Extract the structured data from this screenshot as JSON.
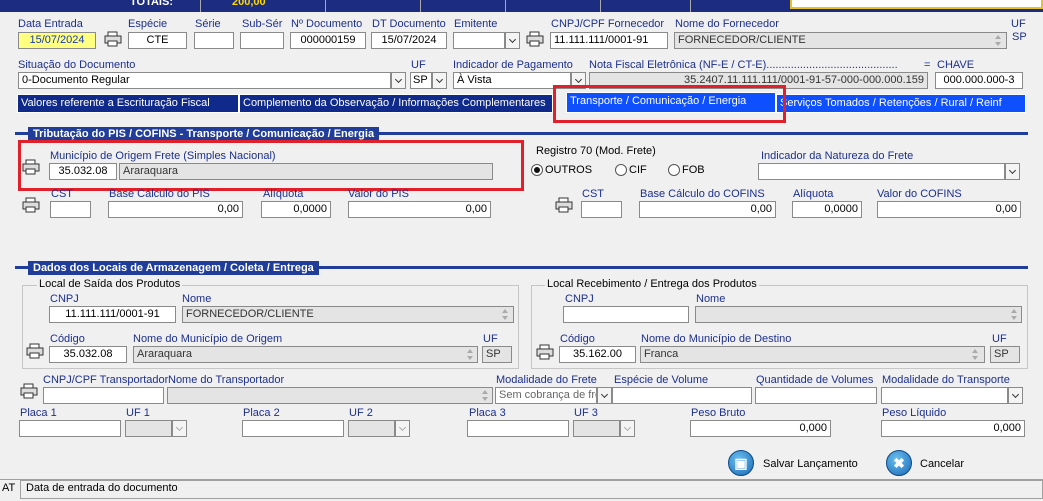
{
  "topbar": {
    "totais_label": "TOTAIS:",
    "totais_value": "200,00"
  },
  "header": {
    "data_entrada_label": "Data Entrada",
    "data_entrada": "15/07/2024",
    "especie_label": "Espécie",
    "especie": "CTE",
    "serie_label": "Série",
    "serie": "",
    "subserie_label": "Sub-Sér",
    "subserie": "",
    "ndoc_label": "Nº Documento",
    "ndoc": "000000159",
    "dtdoc_label": "DT Documento",
    "dtdoc": "15/07/2024",
    "emitente_label": "Emitente",
    "emitente": "",
    "cnpj_label": "CNPJ/CPF Fornecedor",
    "cnpj": "11.111.111/0001-91",
    "fornecedor_label": "Nome do Fornecedor",
    "fornecedor": "FORNECEDOR/CLIENTE",
    "uf_label": "UF",
    "uf": "SP"
  },
  "row2": {
    "situacao_label": "Situação do Documento",
    "situacao": "0-Documento Regular",
    "uf_label": "UF",
    "uf": "SP",
    "pagamento_label": "Indicador de Pagamento",
    "pagamento": "À Vista",
    "nfe_label": "Nota Fiscal Eletrônica (NF-E / CT-E)...........................................",
    "nfe": "35.2407.11.111.111/0001-91-57-000-000.000.159",
    "eq_label": "=",
    "chave_label": "CHAVE",
    "chave": "000.000.000-3"
  },
  "tabs": [
    {
      "label": "Valores referente a Escrituração Fiscal"
    },
    {
      "label": "Complemento da Observação / Informações Complementares"
    },
    {
      "label": "Transporte / Comunicação / Energia"
    },
    {
      "label": "Serviços Tomados / Retenções / Rural / Reinf"
    }
  ],
  "pis": {
    "section_title": "Tributação do PIS / COFINS - Transporte / Comunicação / Energia",
    "municipio_label": "Município de Origem Frete (Simples Nacional)",
    "municipio_code": "35.032.08",
    "municipio_name": "Araraquara",
    "registro_label": "Registro 70 (Mod. Frete)",
    "opt_outros": "OUTROS",
    "opt_cif": "CIF",
    "opt_fob": "FOB",
    "natureza_label": "Indicador da Natureza do Frete",
    "natureza": "",
    "cst_label": "CST",
    "cst": "",
    "base_pis_label": "Base Cálculo do PIS",
    "base_pis": "0,00",
    "aliq_label": "Alíquota",
    "aliq_pis": "0,0000",
    "valor_pis_label": "Valor do PIS",
    "valor_pis": "0,00",
    "cst2_label": "CST",
    "cst2": "",
    "base_cofins_label": "Base Cálculo do COFINS",
    "base_cofins": "0,00",
    "aliq2_label": "Alíquota",
    "aliq_cofins": "0,0000",
    "valor_cofins_label": "Valor do COFINS",
    "valor_cofins": "0,00"
  },
  "locais": {
    "section_title": "Dados dos Locais de Armazenagem / Coleta / Entrega",
    "saida_title": "Local de Saída dos Produtos",
    "saida_cnpj_label": "CNPJ",
    "saida_cnpj": "11.111.111/0001-91",
    "saida_nome_label": "Nome",
    "saida_nome": "FORNECEDOR/CLIENTE",
    "saida_codigo_label": "Código",
    "saida_codigo": "35.032.08",
    "saida_mun_label": "Nome do Município de Origem",
    "saida_mun": "Araraquara",
    "saida_uf_label": "UF",
    "saida_uf": "SP",
    "receb_title": "Local Recebimento / Entrega dos Produtos",
    "receb_cnpj_label": "CNPJ",
    "receb_cnpj": "",
    "receb_nome_label": "Nome",
    "receb_nome": "",
    "receb_codigo_label": "Código",
    "receb_codigo": "35.162.00",
    "receb_mun_label": "Nome do Município de Destino",
    "receb_mun": "Franca",
    "receb_uf_label": "UF",
    "receb_uf": "SP"
  },
  "transporte": {
    "cnpj_label": "CNPJ/CPF Transportador",
    "cnpj": "",
    "nome_label": "Nome do Transportador",
    "nome": "",
    "modalidade_label": "Modalidade do Frete",
    "modalidade": "Sem cobrança de fre",
    "especie_label": "Espécie de Volume",
    "especie": "",
    "qtd_label": "Quantidade de Volumes",
    "qtd": "",
    "modal_transp_label": "Modalidade do Transporte",
    "modal_transp": "",
    "placa1_label": "Placa 1",
    "uf1_label": "UF 1",
    "placa2_label": "Placa 2",
    "uf2_label": "UF 2",
    "placa3_label": "Placa 3",
    "uf3_label": "UF 3",
    "peso_bruto_label": "Peso Bruto",
    "peso_bruto": "0,000",
    "peso_liquido_label": "Peso Líquido",
    "peso_liquido": "0,000"
  },
  "actions": {
    "save_label": "Salvar Lançamento",
    "cancel_label": "Cancelar"
  },
  "status": {
    "left": "AT",
    "message": "Data de entrada do documento"
  },
  "colors": {
    "accent": "#1f3d99",
    "tab_bg": "#0f2a8a",
    "tab_active_bg": "#0e4fff",
    "highlight": "#e0202a"
  }
}
